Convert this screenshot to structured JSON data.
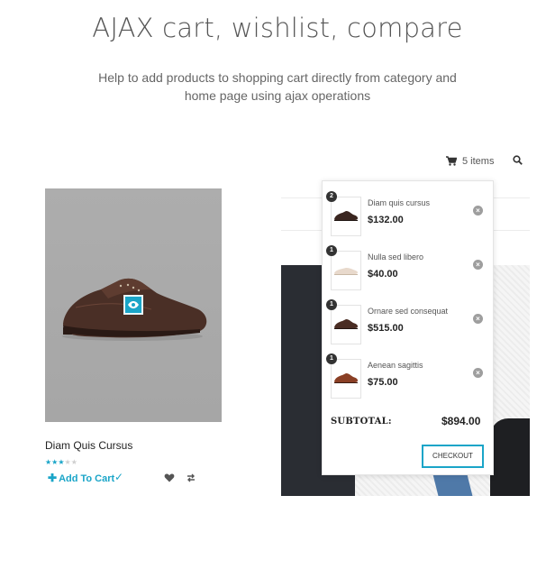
{
  "header": {
    "title": "AJAX cart, wishlist, compare",
    "description": "Help to add products to shopping cart directly from category and home page using ajax operations"
  },
  "product": {
    "name": "Diam Quis Cursus",
    "rating": 3,
    "rating_max": 5,
    "add_to_cart_label": "Add To Cart",
    "add_to_cart_icon": "plus-icon",
    "added_icon": "check-icon",
    "wishlist_icon": "heart-icon",
    "compare_icon": "compare-icon",
    "quickview_icon": "eye-icon"
  },
  "top_bar": {
    "cart_icon": "cart-icon",
    "cart_count": "5 items",
    "search_icon": "search-icon"
  },
  "cart": {
    "items": [
      {
        "qty": "2",
        "name": "Diam quis cursus",
        "price": "$132.00",
        "shoe": "dark-brown-oxford"
      },
      {
        "qty": "1",
        "name": "Nulla sed libero",
        "price": "$40.00",
        "shoe": "cream-loafer"
      },
      {
        "qty": "1",
        "name": "Ornare sed consequat",
        "price": "$515.00",
        "shoe": "brown-oxford"
      },
      {
        "qty": "1",
        "name": "Aenean sagittis",
        "price": "$75.00",
        "shoe": "tan-oxford"
      }
    ],
    "remove_icon": "close-icon",
    "subtotal_label": "SUBTOTAL:",
    "subtotal_value": "$894.00",
    "checkout_label": "CHECKOUT"
  },
  "colors": {
    "accent": "#1aa5c8",
    "text": "#333333",
    "product_bg": "#aaaaaa"
  }
}
